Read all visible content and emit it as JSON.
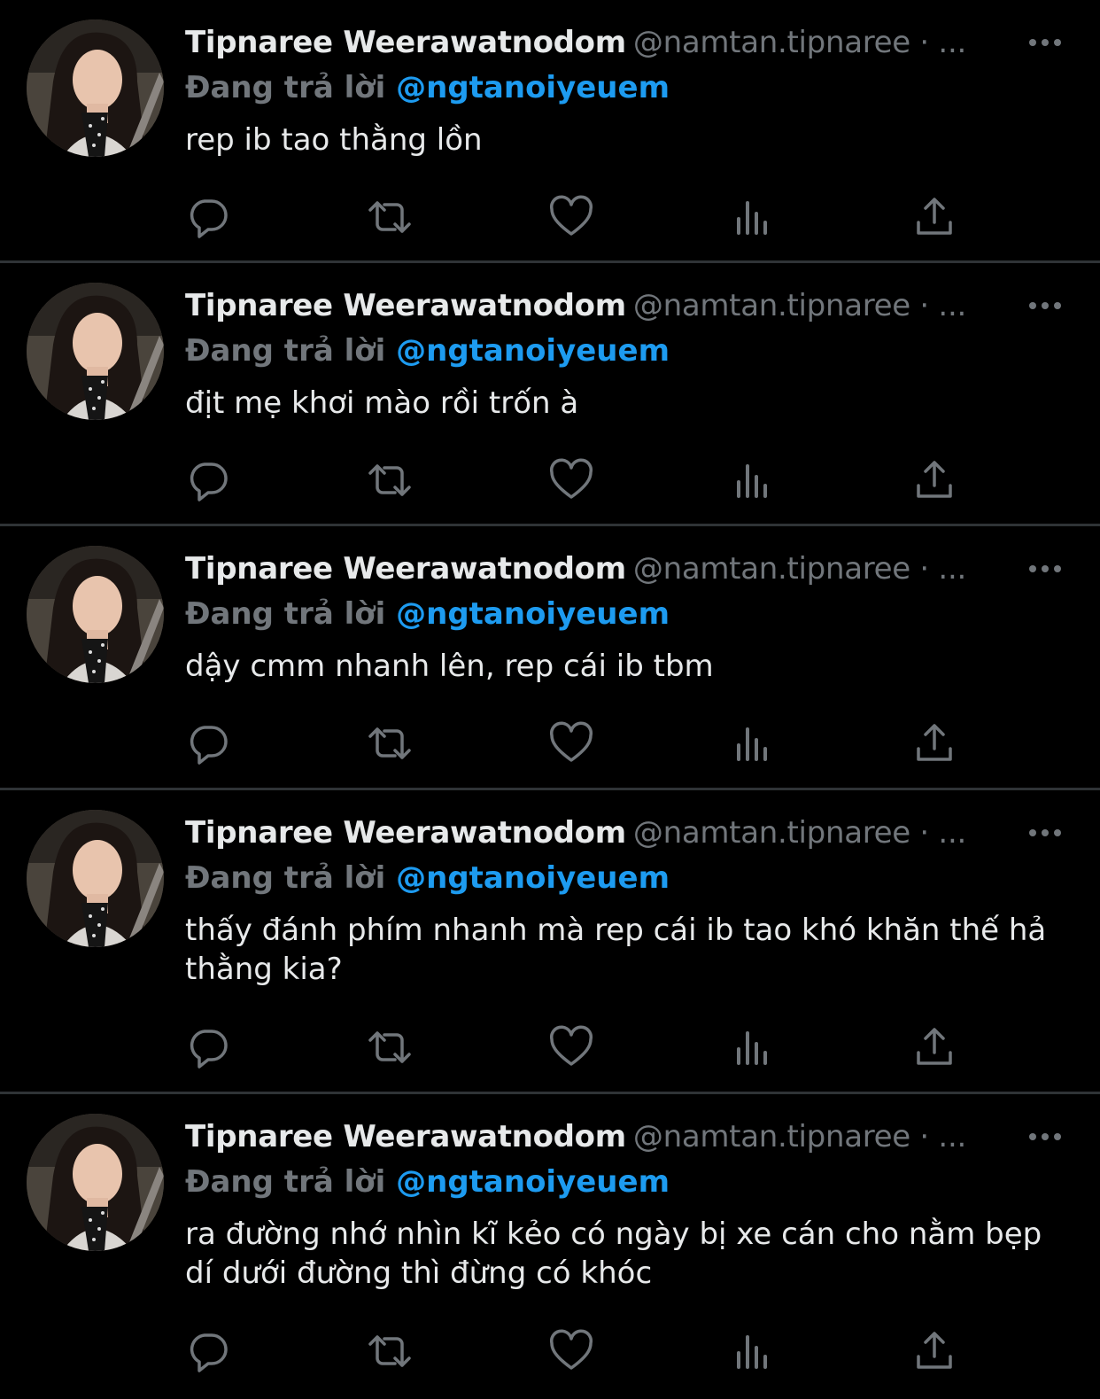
{
  "colors": {
    "background": "#000000",
    "divider": "#2f3336",
    "primary_text": "#e7e9ea",
    "secondary_text": "#71767b",
    "accent": "#1d9bf0"
  },
  "icons": {
    "reply": "speech-bubble-icon",
    "retweet": "retweet-arrows-icon",
    "like": "heart-icon",
    "views": "bar-chart-icon",
    "share": "share-upload-icon",
    "more": "ellipsis-icon"
  },
  "tweets": [
    {
      "author_name": "Tipnaree Weerawatnodom",
      "author_handle": "@namtan.tipnaree · ...",
      "reply_prefix": "Đang trả lời",
      "reply_mention": "@ngtanoiyeuem",
      "text": "rep ib tao thằng lồn"
    },
    {
      "author_name": "Tipnaree Weerawatnodom",
      "author_handle": "@namtan.tipnaree · ...",
      "reply_prefix": "Đang trả lời",
      "reply_mention": "@ngtanoiyeuem",
      "text": "địt mẹ khơi mào rồi trốn à"
    },
    {
      "author_name": "Tipnaree Weerawatnodom",
      "author_handle": "@namtan.tipnaree · ...",
      "reply_prefix": "Đang trả lời",
      "reply_mention": "@ngtanoiyeuem",
      "text": "dậy cmm nhanh lên, rep cái ib tbm"
    },
    {
      "author_name": "Tipnaree Weerawatnodom",
      "author_handle": "@namtan.tipnaree · ...",
      "reply_prefix": "Đang trả lời",
      "reply_mention": "@ngtanoiyeuem",
      "text": "thấy đánh phím nhanh mà rep cái ib tao khó khăn thế hả thằng kia?"
    },
    {
      "author_name": "Tipnaree Weerawatnodom",
      "author_handle": "@namtan.tipnaree · ...",
      "reply_prefix": "Đang trả lời",
      "reply_mention": "@ngtanoiyeuem",
      "text": "ra đường nhớ nhìn kĩ kẻo có ngày bị xe cán cho nằm bẹp dí dưới đường thì đừng có khóc"
    }
  ]
}
